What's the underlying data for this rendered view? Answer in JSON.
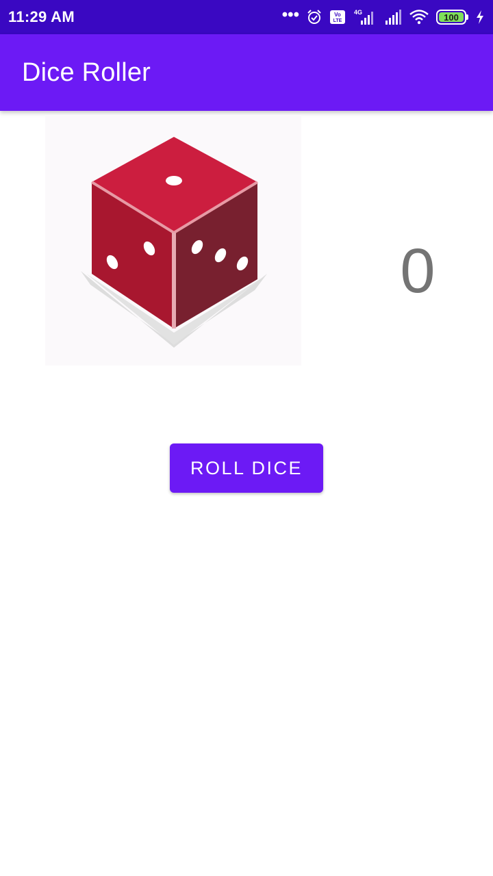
{
  "status_bar": {
    "time": "11:29 AM",
    "icons": [
      "more-dots-icon",
      "alarm-icon",
      "volte-icon",
      "signal-4g-icon",
      "signal-icon",
      "wifi-icon",
      "battery-icon",
      "charging-icon"
    ],
    "volte_label": "Vo LTE",
    "network_label": "4G",
    "battery_level": "100"
  },
  "app_bar": {
    "title": "Dice Roller"
  },
  "main": {
    "dice_image": "red-dice-image",
    "result_value": "0",
    "roll_button_label": "ROLL DICE"
  },
  "colors": {
    "status_bar": "#3a08c2",
    "app_bar": "#6c1af5",
    "button": "#6c1af5",
    "result_text": "#747474",
    "dice_red": "#c81e3e"
  }
}
